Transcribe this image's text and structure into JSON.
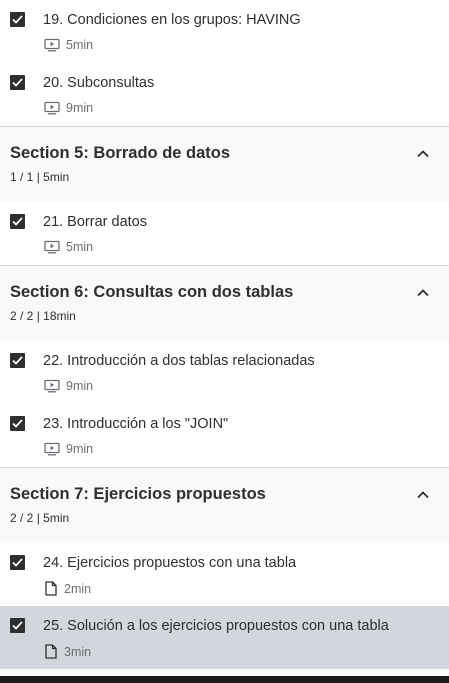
{
  "items": [
    {
      "kind": "lecture",
      "title": "19. Condiciones en los grupos: HAVING",
      "icon": "video-icon",
      "duration": "5min",
      "checked": true,
      "active": false
    },
    {
      "kind": "lecture",
      "title": "20. Subconsultas",
      "icon": "video-icon",
      "duration": "9min",
      "checked": true,
      "active": false
    },
    {
      "kind": "section",
      "title": "Section 5: Borrado de datos",
      "progress": "1 / 1",
      "duration": "5min",
      "expanded": true
    },
    {
      "kind": "lecture",
      "title": "21. Borrar datos",
      "icon": "video-icon",
      "duration": "5min",
      "checked": true,
      "active": false
    },
    {
      "kind": "section",
      "title": "Section 6: Consultas con dos tablas",
      "progress": "2 / 2",
      "duration": "18min",
      "expanded": true
    },
    {
      "kind": "lecture",
      "title": "22. Introducción a dos tablas relacionadas",
      "icon": "video-icon",
      "duration": "9min",
      "checked": true,
      "active": false
    },
    {
      "kind": "lecture",
      "title": "23. Introducción a los \"JOIN\"",
      "icon": "video-icon",
      "duration": "9min",
      "checked": true,
      "active": false
    },
    {
      "kind": "section",
      "title": "Section 7: Ejercicios propuestos",
      "progress": "2 / 2",
      "duration": "5min",
      "expanded": true
    },
    {
      "kind": "lecture",
      "title": "24. Ejercicios propuestos con una tabla",
      "icon": "file-icon",
      "duration": "2min",
      "checked": true,
      "active": false
    },
    {
      "kind": "lecture",
      "title": "25. Solución a los ejercicios propuestos con una tabla",
      "icon": "file-icon",
      "duration": "3min",
      "checked": true,
      "active": true
    }
  ],
  "colors": {
    "text": "#2d2f31",
    "muted": "#6a6f73",
    "section_bg": "#f7f9fa",
    "active_bg": "#d1d7dc",
    "divider": "#d1d7dc",
    "bottom_bar": "#1c1d1f"
  }
}
